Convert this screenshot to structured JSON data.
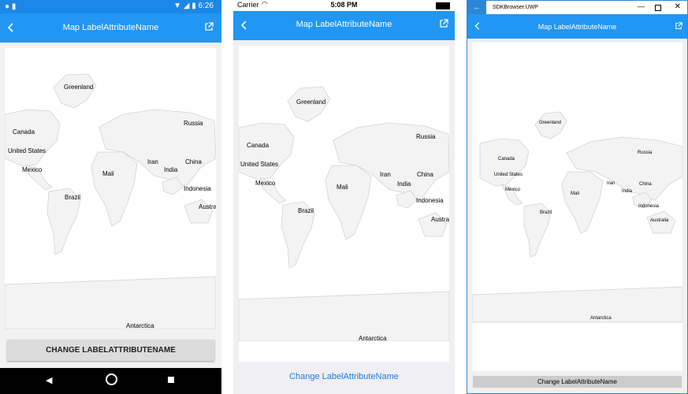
{
  "android": {
    "status": {
      "time": "6:26"
    },
    "title": "Map LabelAttributeName",
    "button_label": "CHANGE LABELATTRIBUTENAME",
    "labels": [
      "Greenland",
      "Canada",
      "United States",
      "Mexico",
      "Brazil",
      "Mali",
      "Iran",
      "India",
      "China",
      "Russia",
      "Indonesia",
      "Austra",
      "Antarctica"
    ]
  },
  "ios": {
    "status": {
      "carrier": "Carrier",
      "time": "5:08 PM"
    },
    "title": "Map LabelAttributeName",
    "button_label": "Change LabelAttributeName",
    "labels": [
      "Greenland",
      "Canada",
      "United States",
      "Mexico",
      "Brazil",
      "Mali",
      "Iran",
      "India",
      "China",
      "Russia",
      "Indonesia",
      "Austra",
      "Antarctica"
    ]
  },
  "uwp": {
    "window_title": "SDKBrowser.UWP",
    "title": "Map LabelAttributeName",
    "button_label": "Change LabelAttributeName",
    "labels": [
      "Greenland",
      "Canada",
      "United States",
      "Mexico",
      "Brazil",
      "Mali",
      "Iran",
      "India",
      "China",
      "Russia",
      "Indonesia",
      "Australia",
      "Antarctica"
    ]
  },
  "icons": {
    "back": "back-arrow-icon",
    "open": "open-external-icon",
    "minimize": "minimize-icon",
    "maximize": "maximize-icon",
    "close": "close-icon"
  },
  "colors": {
    "app_bar": "#2196f3",
    "android_status": "#1b87e6",
    "ios_link": "#1f7ae0",
    "map_land": "#f3f3f3",
    "map_border": "#d2d2d2"
  }
}
